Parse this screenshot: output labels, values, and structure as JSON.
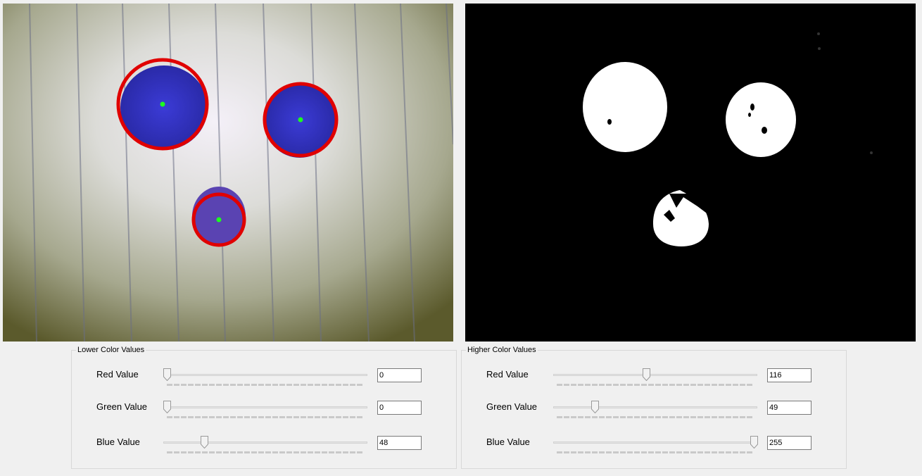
{
  "lower": {
    "title": "Lower Color Values",
    "red": {
      "label": "Red Value",
      "value": "0"
    },
    "green": {
      "label": "Green Value",
      "value": "0"
    },
    "blue": {
      "label": "Blue Value",
      "value": "48"
    }
  },
  "higher": {
    "title": "Higher Color Values",
    "red": {
      "label": "Red Value",
      "value": "116"
    },
    "green": {
      "label": "Green Value",
      "value": "49"
    },
    "blue": {
      "label": "Blue Value",
      "value": "255"
    }
  },
  "slider_range": [
    0,
    255
  ],
  "colors": {
    "circle": "#e00000",
    "center": "#1dff1d",
    "blob": "#3a3ad0",
    "mask_bg": "#000000",
    "mask_fg": "#ffffff"
  },
  "icons": [
    "slider-thumb-icon"
  ]
}
